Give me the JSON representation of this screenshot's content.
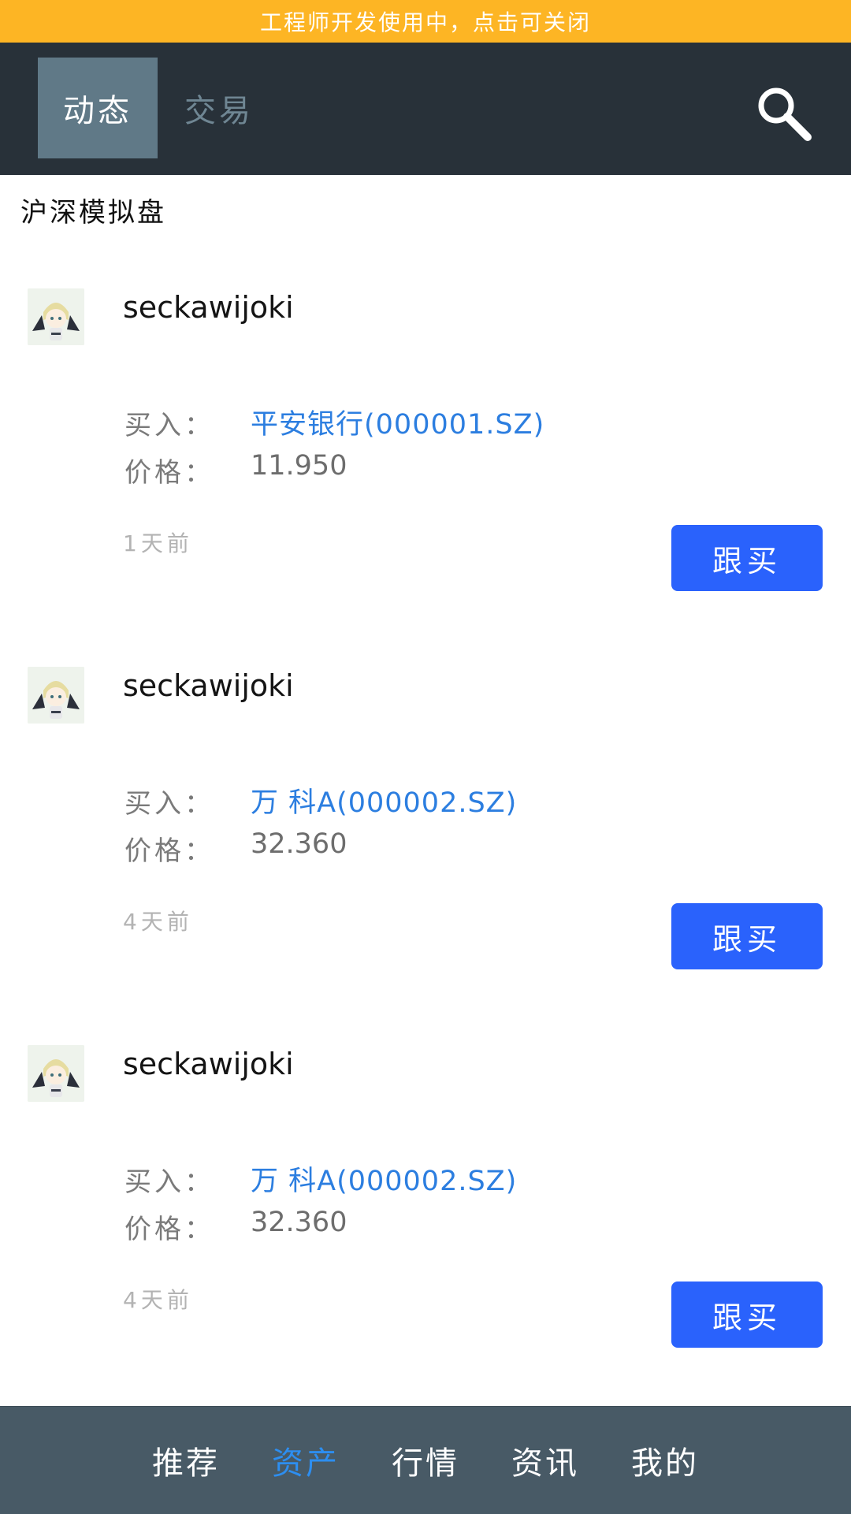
{
  "banner": {
    "text": "工程师开发使用中，点击可关闭"
  },
  "header": {
    "tabs": [
      {
        "label": "动态",
        "active": true
      },
      {
        "label": "交易",
        "active": false
      }
    ],
    "search_icon": "search-icon"
  },
  "section": {
    "title": "沪深模拟盘"
  },
  "feed": [
    {
      "username": "seckawijoki",
      "action_label": "买入：",
      "stock": "平安银行(000001.SZ)",
      "price_label": "价格：",
      "price": "11.950",
      "time": "1天前",
      "button": "跟买"
    },
    {
      "username": "seckawijoki",
      "action_label": "买入：",
      "stock": "万 科A(000002.SZ)",
      "price_label": "价格：",
      "price": "32.360",
      "time": "4天前",
      "button": "跟买"
    },
    {
      "username": "seckawijoki",
      "action_label": "买入：",
      "stock": "万 科A(000002.SZ)",
      "price_label": "价格：",
      "price": "32.360",
      "time": "4天前",
      "button": "跟买"
    }
  ],
  "bottom_nav": {
    "items": [
      {
        "label": "推荐",
        "active": false
      },
      {
        "label": "资产",
        "active": true
      },
      {
        "label": "行情",
        "active": false
      },
      {
        "label": "资讯",
        "active": false
      },
      {
        "label": "我的",
        "active": false
      }
    ]
  },
  "colors": {
    "banner": "#fdb524",
    "header": "#283139",
    "tab_active_bg": "#607987",
    "link": "#2c7ee0",
    "button": "#2a62fc",
    "nav_bg": "#485a66",
    "nav_active": "#2d8ef0"
  }
}
